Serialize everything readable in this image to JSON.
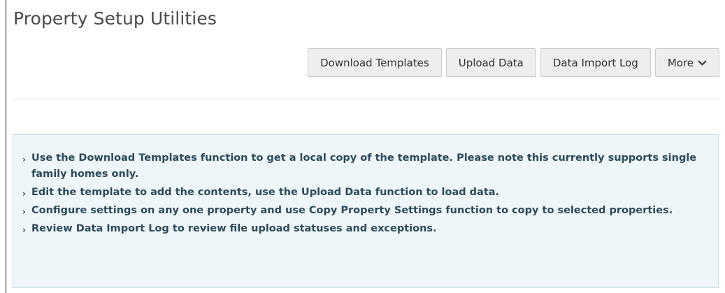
{
  "header": {
    "title": "Property Setup Utilities"
  },
  "toolbar": {
    "buttons": [
      {
        "label": "Download Templates"
      },
      {
        "label": "Upload Data"
      },
      {
        "label": "Data Import Log"
      },
      {
        "label": "More",
        "icon": "chevron-down-icon"
      }
    ]
  },
  "info": {
    "bullet_glyph": "›",
    "items": [
      "Use the Download Templates function to get a local copy of the template. Please note this currently supports single family homes only.",
      "Edit the template to add the contents, use the Upload Data function to load data.",
      "Configure settings on any one property and use Copy Property Settings function to copy to selected properties.",
      "Review Data Import Log to review file upload statuses and exceptions."
    ]
  }
}
